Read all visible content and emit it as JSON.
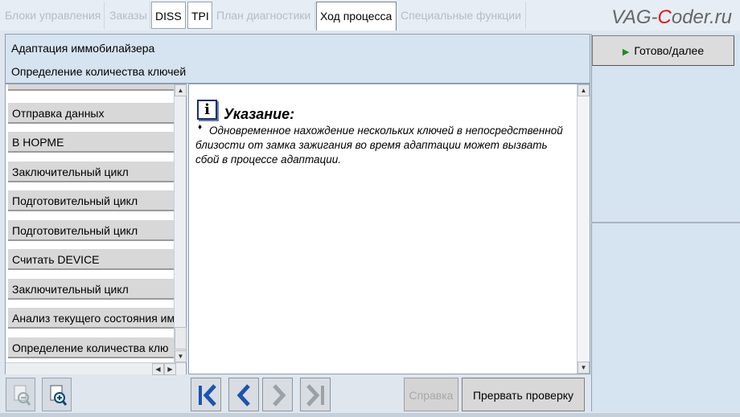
{
  "tabs": [
    {
      "label": "Блоки управления",
      "state": "disabled"
    },
    {
      "label": "Заказы",
      "state": "disabled"
    },
    {
      "label": "DISS",
      "state": "enabled"
    },
    {
      "label": "TPI",
      "state": "enabled"
    },
    {
      "label": "План диагностики",
      "state": "disabled"
    },
    {
      "label": "Ход процесса",
      "state": "active"
    },
    {
      "label": "Специальные функции",
      "state": "disabled"
    }
  ],
  "watermark": {
    "prefix": "VAG-",
    "highlight": "C",
    "suffix": "oder.ru"
  },
  "header": {
    "title": "Адаптация иммобилайзера",
    "subtitle": "Определение количества ключей"
  },
  "steps": [
    "Отправка данных",
    "В НОРМЕ",
    "Заключительный цикл",
    "Подготовительный цикл",
    "Подготовительный цикл",
    "Считать DEVICE",
    "Заключительный цикл",
    "Анализ текущего состояния им",
    "Определение количества клю"
  ],
  "notice": {
    "icon": "info-icon",
    "heading": "Указание:",
    "bullet": "♦",
    "text": "Одновременное нахождение нескольких ключей в непосредственной близости от замка зажигания во время адаптации может вызвать сбой в процессе адаптации."
  },
  "buttons": {
    "done": "Готово/далее",
    "help": "Справка",
    "abort": "Прервать проверку"
  },
  "colors": {
    "accent_blue": "#1a55b0",
    "watermark_red": "#e8101a",
    "play_green": "#1f8a1f"
  }
}
